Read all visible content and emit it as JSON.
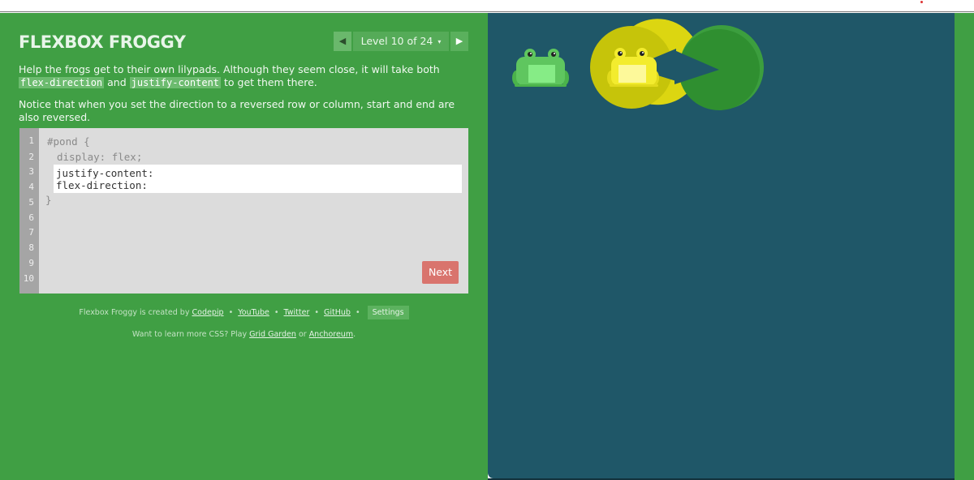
{
  "title": "FLEXBOX FROGGY",
  "level_nav": {
    "prev_icon": "triangle-left-icon",
    "next_icon": "triangle-right-icon",
    "label": "Level 10 of 24",
    "caret": "▾"
  },
  "instructions": {
    "p1_before": "Help the frogs get to their own lilypads. Although they seem close, it will take both",
    "p1_code1": "flex-direction",
    "p1_mid": "and",
    "p1_code2": "justify-content",
    "p1_after": "to get them there.",
    "p2": "Notice that when you set the direction to a reversed row or column, start and end are also reversed."
  },
  "editor": {
    "line_numbers": [
      "1",
      "2",
      "3",
      "4",
      "5",
      "6",
      "7",
      "8",
      "9",
      "10"
    ],
    "line1": "#pond {",
    "line2": "display: flex;",
    "input_line1": "justify-content:",
    "input_line2": "flex-direction:",
    "line5": "}"
  },
  "next_button": "Next",
  "credits": {
    "prefix": "Flexbox Froggy is created by",
    "codepip": "Codepip",
    "youtube": "YouTube",
    "twitter": "Twitter",
    "github": "GitHub",
    "bullet": "•",
    "settings": "Settings"
  },
  "more": {
    "prefix": "Want to learn more CSS? Play",
    "grid_garden": "Grid Garden",
    "or": "or",
    "anchoreum": "Anchoreum",
    "suffix": "."
  },
  "colors": {
    "sidebar_green": "#409f44",
    "pond_blue": "#1f5768",
    "next_button": "#d9746d",
    "frog_green": "#5fc65f",
    "frog_yellow": "#f3ec2e",
    "lilypad_yellow": "#c6c40a",
    "lilypad_green": "#2f8f30"
  }
}
